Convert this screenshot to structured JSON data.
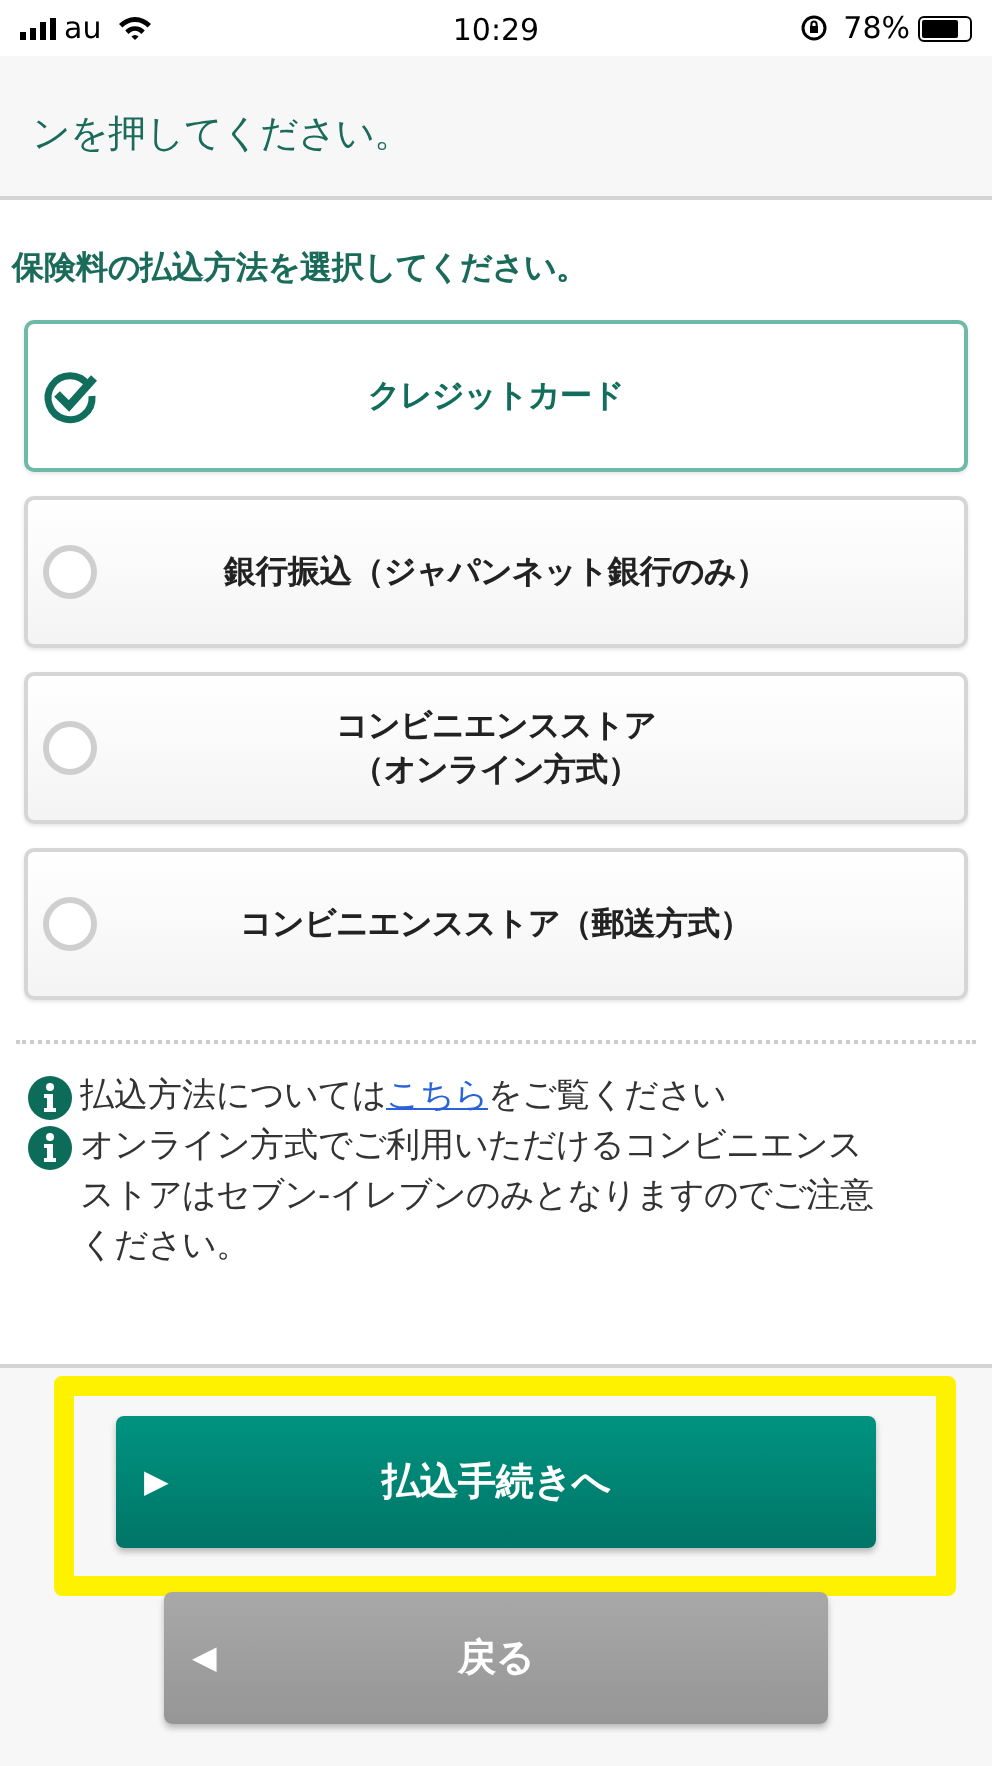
{
  "status_bar": {
    "carrier": "au",
    "time": "10:29",
    "battery": "78%"
  },
  "intro": "ンを押してください。",
  "question": "保険料の払込方法を選択してください。",
  "options": [
    {
      "label": "クレジットカード",
      "selected": true
    },
    {
      "label": "銀行振込（ジャパンネット銀行のみ）",
      "selected": false
    },
    {
      "label": "コンビニエンスストア",
      "label_line_2": "（オンライン方式）",
      "selected": false
    },
    {
      "label": "コンビニエンスストア（郵送方式）",
      "selected": false
    }
  ],
  "notes": [
    {
      "before": "払込方法については",
      "link": "こちら",
      "after": "をご覧ください"
    },
    {
      "before": "オンライン方式でご利用いただけるコンビニエンスストアはセブン-イレブンのみとなりますのでご注意ください。"
    }
  ],
  "buttons": [
    {
      "kind": "primary",
      "label": "払込手続きへ",
      "arrow": "▶",
      "highlighted": true
    },
    {
      "kind": "secondary",
      "label": "戻る",
      "arrow": "◀",
      "highlighted": false
    }
  ]
}
